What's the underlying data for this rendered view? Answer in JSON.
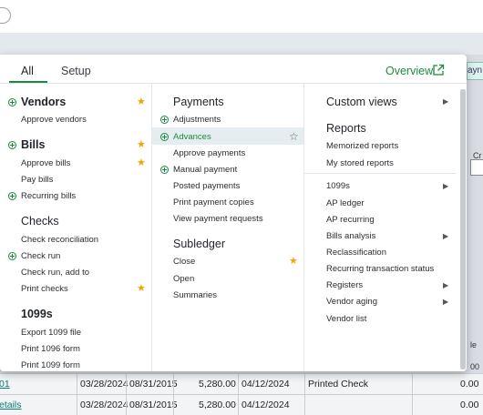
{
  "menu": {
    "tabs": [
      {
        "label": "All"
      },
      {
        "label": "Setup"
      }
    ],
    "overview_label": "Overview",
    "col1": {
      "vendors": "Vendors",
      "approve_vendors": "Approve vendors",
      "bills": "Bills",
      "approve_bills": "Approve bills",
      "pay_bills": "Pay bills",
      "recurring_bills": "Recurring bills",
      "checks": "Checks",
      "check_reconciliation": "Check reconciliation",
      "check_run": "Check run",
      "check_run_add_to": "Check run, add to",
      "print_checks": "Print checks",
      "h1099s": "1099s",
      "export_1099": "Export 1099 file",
      "print_1096": "Print 1096 form",
      "print_1099": "Print 1099 form"
    },
    "col2": {
      "payments": "Payments",
      "adjustments": "Adjustments",
      "advances": "Advances",
      "approve_payments": "Approve payments",
      "manual_payment": "Manual payment",
      "posted_payments": "Posted payments",
      "print_payment_copies": "Print payment copies",
      "view_payment_requests": "View payment requests",
      "subledger": "Subledger",
      "close": "Close",
      "open": "Open",
      "summaries": "Summaries"
    },
    "col3": {
      "custom_views": "Custom views",
      "reports": "Reports",
      "memorized_reports": "Memorized reports",
      "my_stored_reports": "My stored reports",
      "r1099s": "1099s",
      "ap_ledger": "AP ledger",
      "ap_recurring": "AP recurring",
      "bills_analysis": "Bills analysis",
      "reclassification": "Reclassification",
      "recurring_transaction_status": "Recurring transaction status",
      "registers": "Registers",
      "vendor_aging": "Vendor aging",
      "vendor_list": "Vendor list"
    }
  },
  "background": {
    "tab_fragment": "ayn",
    "frag_cr": "Cr",
    "frag_le": "le",
    "frag_00": "00",
    "rows": [
      {
        "id": "01",
        "date1": "03/28/2024",
        "date2": "08/31/2015",
        "amount": "5,280.00",
        "date3": "04/12/2024",
        "type": "Printed Check",
        "total": "0.00"
      },
      {
        "id": "etails",
        "date1": "03/28/2024",
        "date2": "08/31/2015",
        "amount": "5,280.00",
        "date3": "04/12/2024",
        "type": "",
        "total": "0.00"
      }
    ]
  },
  "colors": {
    "accent_green": "#1c8a3e",
    "star": "#f0a500",
    "highlight": "#e6edf0"
  }
}
